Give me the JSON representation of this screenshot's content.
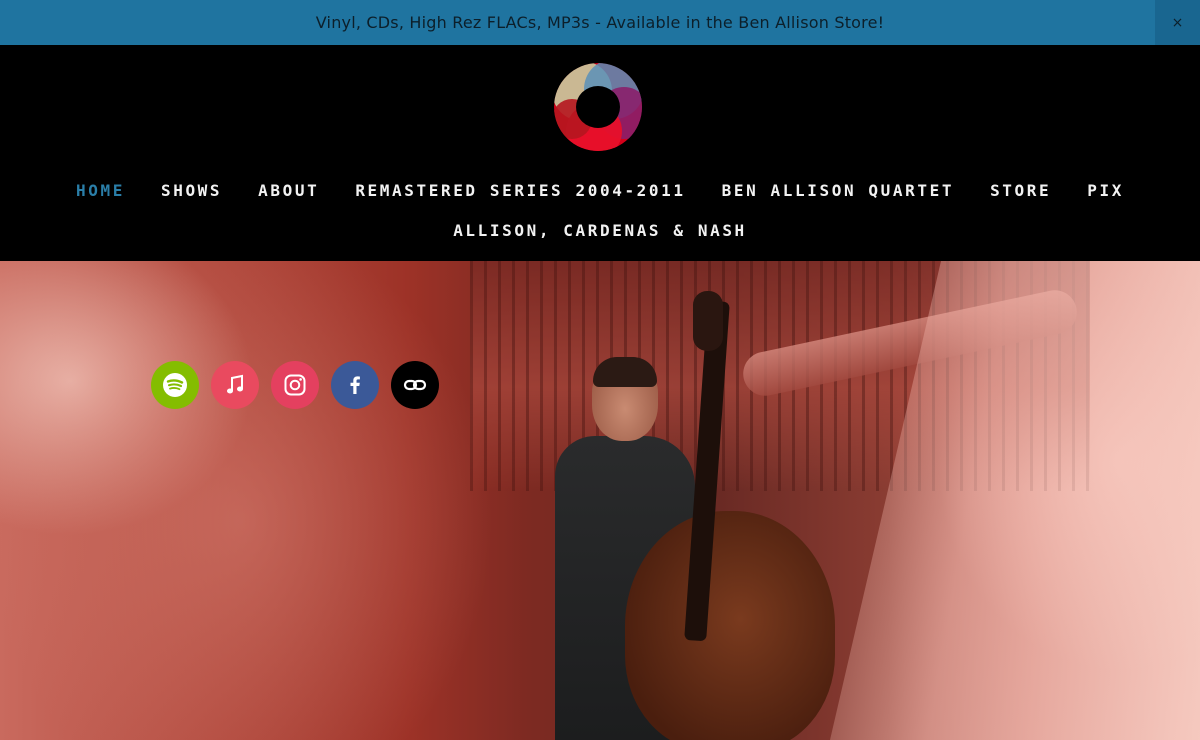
{
  "announcement": {
    "text": "Vinyl, CDs, High Rez FLACs, MP3s - Available in the Ben Allison Store!",
    "close_label": "×"
  },
  "nav": {
    "row1": [
      "HOME",
      "SHOWS",
      "ABOUT",
      "REMASTERED SERIES 2004-2011",
      "BEN ALLISON QUARTET",
      "STORE",
      "PIX"
    ],
    "row2": [
      "ALLISON, CARDENAS & NASH"
    ],
    "active": "HOME"
  },
  "socials": [
    {
      "name": "spotify-icon",
      "color": "#84bd00"
    },
    {
      "name": "apple-music-icon",
      "color": "#e94a5f"
    },
    {
      "name": "instagram-icon",
      "color": "#e4405f"
    },
    {
      "name": "facebook-icon",
      "color": "#3b5998"
    },
    {
      "name": "link-icon",
      "color": "#000000"
    }
  ],
  "colors": {
    "announcement_bg": "#1f74a0",
    "header_bg": "#000000",
    "nav_text": "#f2f2f2",
    "nav_active": "#2a7ea8"
  }
}
